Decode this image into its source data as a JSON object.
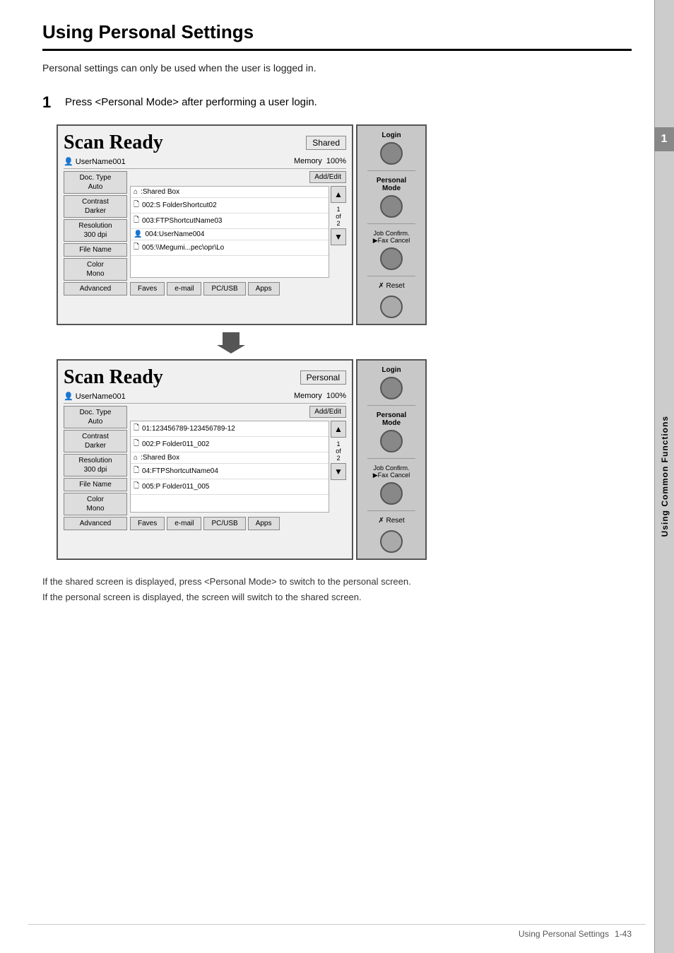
{
  "page": {
    "title": "Using Personal Settings",
    "section_number": "1",
    "intro": "Personal settings can only be used when the user is logged in.",
    "step1_label": "1",
    "step1_text": "Press <Personal Mode> after performing a user login.",
    "footer_text_line1": "If the shared screen is displayed, press <Personal Mode> to switch to the personal screen.",
    "footer_text_line2": "If the personal screen is displayed, the screen will switch to the shared screen.",
    "page_footer": "Using Personal Settings",
    "page_number": "1-43",
    "side_tab_text": "Using Common Functions"
  },
  "screen1": {
    "title": "Scan Ready",
    "mode_badge": "Shared",
    "user": "UserName001",
    "memory_label": "Memory",
    "memory_value": "100%",
    "left_col": [
      {
        "label": "Doc. Type\nAuto"
      },
      {
        "label": "Contrast\nDarker"
      },
      {
        "label": "Resolution\n300 dpi"
      },
      {
        "label": "File Name"
      },
      {
        "label": "Color\nMono"
      },
      {
        "label": "Advanced"
      }
    ],
    "add_edit_btn": "Add/Edit",
    "list_items": [
      {
        "icon": "📁",
        "text": "⌂:Shared Box"
      },
      {
        "icon": "📄",
        "text": "002:S FolderShortcut02"
      },
      {
        "icon": "📄",
        "text": "003:FTPShortcutName03"
      },
      {
        "icon": "👤",
        "text": "004:UserName004"
      },
      {
        "icon": "📄",
        "text": "005:\\\\Megumi...pec\\opr\\Lo"
      }
    ],
    "page_indicator": "1\nof\n2",
    "bottom_tabs": [
      "Faves",
      "e-mail",
      "PC/USB",
      "Apps"
    ],
    "scroll_up": "▲",
    "scroll_down": "▼"
  },
  "screen2": {
    "title": "Scan Ready",
    "mode_badge": "Personal",
    "user": "UserName001",
    "memory_label": "Memory",
    "memory_value": "100%",
    "left_col": [
      {
        "label": "Doc. Type\nAuto"
      },
      {
        "label": "Contrast\nDarker"
      },
      {
        "label": "Resolution\n300 dpi"
      },
      {
        "label": "File Name"
      },
      {
        "label": "Color\nMono"
      },
      {
        "label": "Advanced"
      }
    ],
    "add_edit_btn": "Add/Edit",
    "list_items": [
      {
        "icon": "📄",
        "text": "01:123456789-123456789-12"
      },
      {
        "icon": "📄",
        "text": "002:P Folder011_002"
      },
      {
        "icon": "📁",
        "text": "⌂:Shared Box"
      },
      {
        "icon": "📄",
        "text": "04:FTPShortcutName04"
      },
      {
        "icon": "📄",
        "text": "005:P Folder011_005"
      }
    ],
    "page_indicator": "1\nof\n2",
    "bottom_tabs": [
      "Faves",
      "e-mail",
      "PC/USB",
      "Apps"
    ],
    "scroll_up": "▲",
    "scroll_down": "▼"
  },
  "hardware": {
    "login_label": "Login",
    "personal_mode_label": "Personal\nMode",
    "job_confirm_label": "Job Confirm.\n▶Fax Cancel",
    "reset_label": "✗ Reset"
  }
}
